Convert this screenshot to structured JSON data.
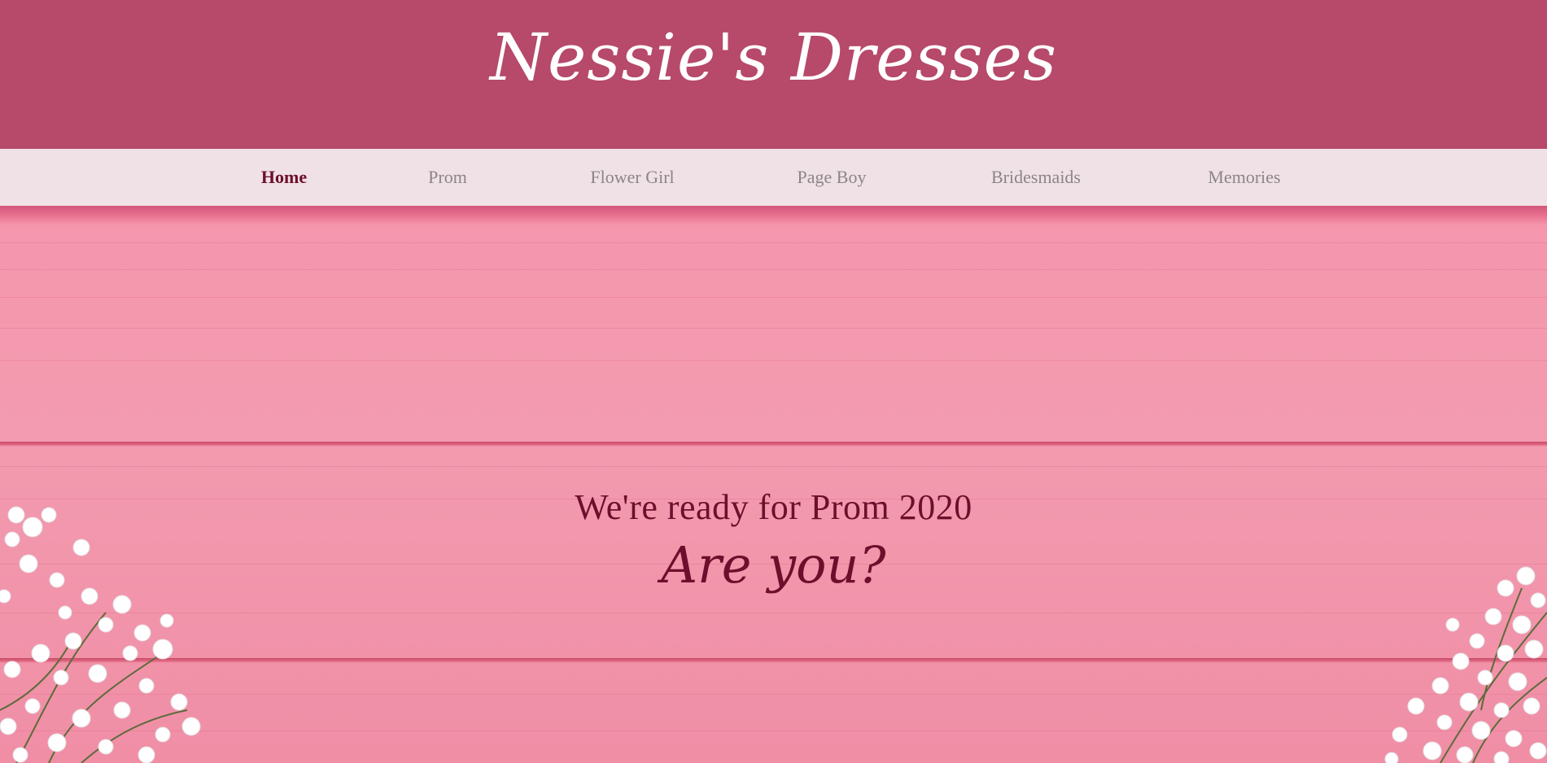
{
  "header": {
    "title": "Nessie's Dresses"
  },
  "nav": {
    "items": [
      {
        "label": "Home",
        "active": true
      },
      {
        "label": "Prom",
        "active": false
      },
      {
        "label": "Flower Girl",
        "active": false
      },
      {
        "label": "Page Boy",
        "active": false
      },
      {
        "label": "Bridesmaids",
        "active": false
      },
      {
        "label": "Memories",
        "active": false
      }
    ]
  },
  "hero": {
    "heading": "We're ready for Prom 2020",
    "subheading": "Are you?",
    "background_image": "pink-wooden-planks-with-white-babys-breath-flowers"
  },
  "colors": {
    "header_bg": "#b7496a",
    "nav_bg": "#f0e1e6",
    "nav_active": "#6d0f2c",
    "nav_inactive": "#8b8587",
    "hero_text": "#6d0f2c"
  }
}
